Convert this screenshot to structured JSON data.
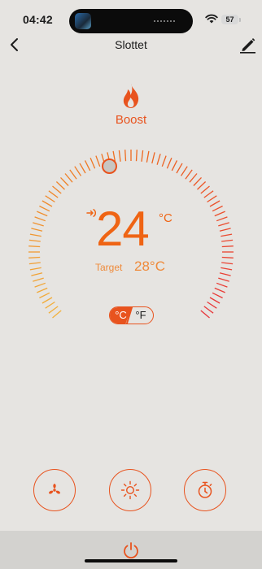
{
  "status_bar": {
    "time": "04:42",
    "battery": "57"
  },
  "nav": {
    "title": "Slottet",
    "back_icon": "chevron-left-icon",
    "edit_icon": "edit-pencil-icon"
  },
  "mode": {
    "icon": "flame-icon",
    "label": "Boost"
  },
  "thermostat": {
    "current": "24",
    "unit": "°C",
    "target_label": "Target",
    "target_value": "28°C",
    "units": {
      "celsius": "°C",
      "fahrenheit": "°F",
      "selected": "celsius"
    }
  },
  "controls": [
    {
      "name": "fan",
      "icon": "fan-icon"
    },
    {
      "name": "light",
      "icon": "sun-icon"
    },
    {
      "name": "timer",
      "icon": "stopwatch-icon"
    }
  ],
  "power": {
    "icon": "power-icon"
  },
  "colors": {
    "accent": "#e8531e",
    "temperature": "#ef6414",
    "dial_cool": "#f2b13c",
    "dial_hot": "#e8353a",
    "background": "#e6e4e1"
  }
}
